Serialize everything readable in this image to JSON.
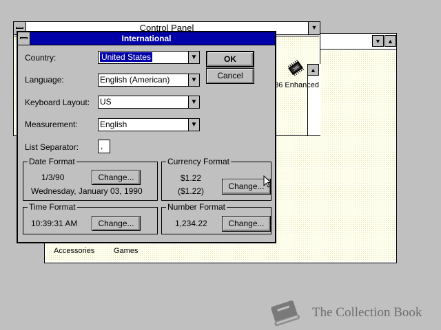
{
  "control_panel": {
    "title": "Control Panel",
    "icon_label": "386 Enhanced"
  },
  "program_manager": {
    "groups": [
      "Accessories",
      "Games"
    ]
  },
  "dialog": {
    "title": "International",
    "country_label": "Country:",
    "country_value": "United States",
    "language_label": "Language:",
    "language_value": "English (American)",
    "keyboard_label": "Keyboard Layout:",
    "keyboard_value": "US",
    "measurement_label": "Measurement:",
    "measurement_value": "English",
    "list_sep_label": "List Separator:",
    "list_sep_value": ",",
    "ok_label": "OK",
    "cancel_label": "Cancel",
    "date_format": {
      "title": "Date Format",
      "short": "1/3/90",
      "long": "Wednesday, January 03, 1990",
      "change_label": "Change..."
    },
    "currency_format": {
      "title": "Currency Format",
      "positive": "$1.22",
      "negative": "($1.22)",
      "change_label": "Change..."
    },
    "time_format": {
      "title": "Time Format",
      "value": "10:39:31 AM",
      "change_label": "Change..."
    },
    "number_format": {
      "title": "Number Format",
      "value": "1,234.22",
      "change_label": "Change..."
    }
  },
  "watermark": {
    "text": "The Collection Book"
  }
}
